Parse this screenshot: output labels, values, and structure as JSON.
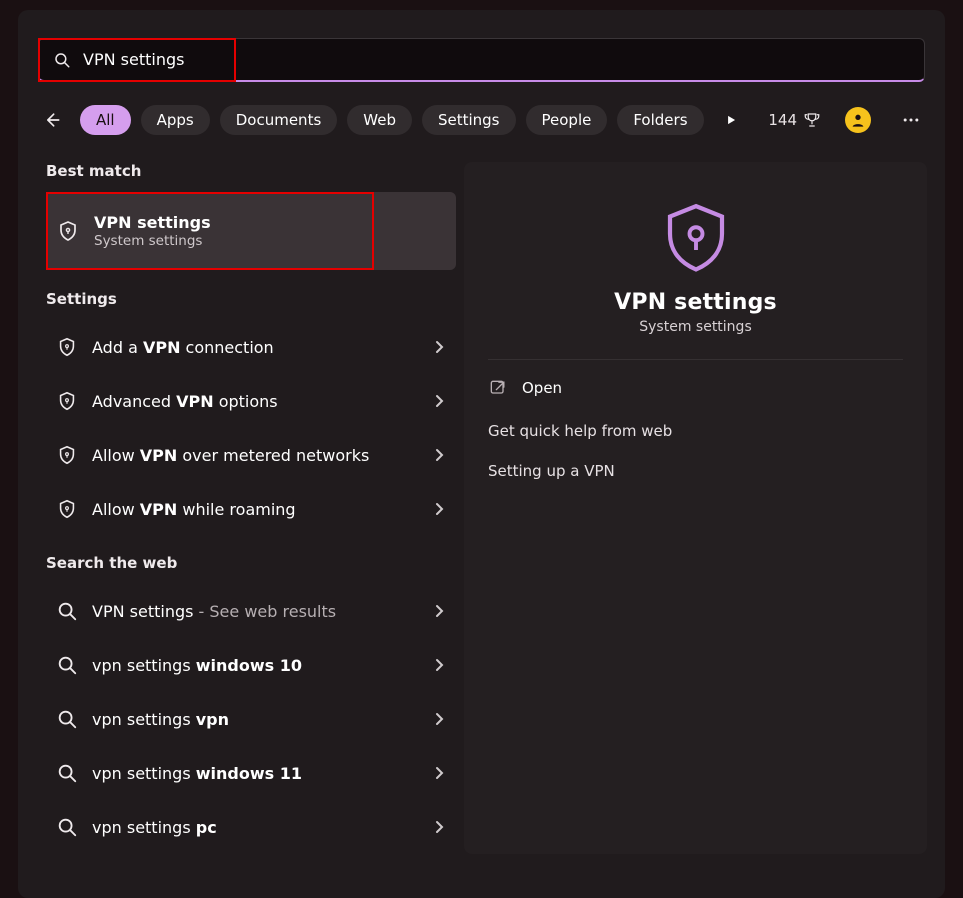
{
  "search": {
    "value": "VPN settings"
  },
  "filters": {
    "items": [
      {
        "label": "All",
        "active": true
      },
      {
        "label": "Apps"
      },
      {
        "label": "Documents"
      },
      {
        "label": "Web"
      },
      {
        "label": "Settings"
      },
      {
        "label": "People"
      },
      {
        "label": "Folders"
      }
    ]
  },
  "points": {
    "value": "144"
  },
  "left": {
    "best": {
      "label": "Best match",
      "item": {
        "title": "VPN settings",
        "subtitle": "System settings"
      }
    },
    "settings": {
      "label": "Settings",
      "items": [
        {
          "pre": "Add a ",
          "bold": "VPN",
          "post": " connection"
        },
        {
          "pre": "Advanced ",
          "bold": "VPN",
          "post": " options"
        },
        {
          "pre": "Allow ",
          "bold": "VPN",
          "post": " over metered networks"
        },
        {
          "pre": "Allow ",
          "bold": "VPN",
          "post": " while roaming"
        }
      ]
    },
    "web": {
      "label": "Search the web",
      "items": [
        {
          "main": "VPN settings",
          "suffix": " - See web results"
        },
        {
          "pre": "vpn settings ",
          "bold": "windows 10",
          "post": ""
        },
        {
          "pre": "vpn settings ",
          "bold": "vpn",
          "post": ""
        },
        {
          "pre": "vpn settings ",
          "bold": "windows 11",
          "post": ""
        },
        {
          "pre": "vpn settings ",
          "bold": "pc",
          "post": ""
        }
      ]
    }
  },
  "right": {
    "title": "VPN settings",
    "subtitle": "System settings",
    "open": "Open",
    "help_label": "Get quick help from web",
    "help_link": "Setting up a VPN"
  }
}
